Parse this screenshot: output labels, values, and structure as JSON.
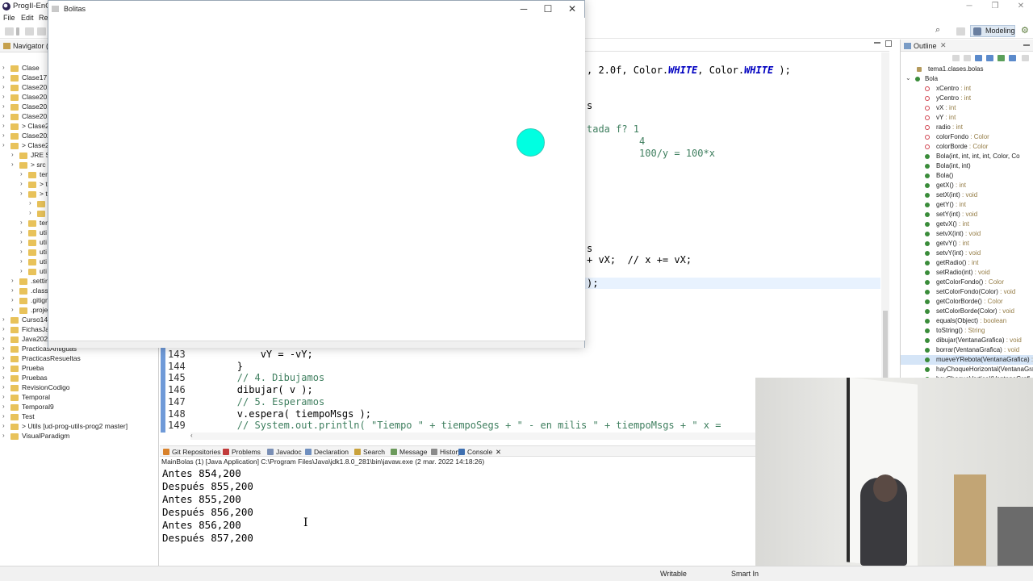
{
  "eclipse": {
    "title": "ProgII-EnCl",
    "menu": [
      "File",
      "Edit",
      "Re"
    ],
    "perspective": "Modeling"
  },
  "navigator": {
    "title": "Navigator (D",
    "items": [
      {
        "label": "Clase",
        "indent": 0
      },
      {
        "label": "Clase17",
        "indent": 0
      },
      {
        "label": "Clase201",
        "indent": 0
      },
      {
        "label": "Clase201",
        "indent": 0
      },
      {
        "label": "Clase201",
        "indent": 0
      },
      {
        "label": "Clase201",
        "indent": 0
      },
      {
        "label": "> Clase2",
        "indent": 0
      },
      {
        "label": "Clase202",
        "indent": 0
      },
      {
        "label": "> Clase2",
        "indent": 0
      },
      {
        "label": "JRE Sy",
        "indent": 1
      },
      {
        "label": "> src",
        "indent": 1
      },
      {
        "label": "ter",
        "indent": 2
      },
      {
        "label": "> t",
        "indent": 2
      },
      {
        "label": "> t",
        "indent": 2
      },
      {
        "label": "",
        "indent": 3
      },
      {
        "label": "",
        "indent": 3
      },
      {
        "label": "ter",
        "indent": 2
      },
      {
        "label": "uti",
        "indent": 2
      },
      {
        "label": "uti",
        "indent": 2
      },
      {
        "label": "uti",
        "indent": 2
      },
      {
        "label": "uti",
        "indent": 2
      },
      {
        "label": "uti",
        "indent": 2
      },
      {
        "label": ".settir",
        "indent": 1
      },
      {
        "label": ".classp",
        "indent": 1
      },
      {
        "label": ".gitign",
        "indent": 1
      },
      {
        "label": ".proje",
        "indent": 1
      },
      {
        "label": "Curso141",
        "indent": 0
      },
      {
        "label": "FichasJav",
        "indent": 0
      },
      {
        "label": "Java2022",
        "indent": 0
      },
      {
        "label": "PracticasAntiguas",
        "indent": 0
      },
      {
        "label": "PracticasResueltas",
        "indent": 0
      },
      {
        "label": "Prueba",
        "indent": 0
      },
      {
        "label": "Pruebas",
        "indent": 0
      },
      {
        "label": "RevisionCodigo",
        "indent": 0
      },
      {
        "label": "Temporal",
        "indent": 0
      },
      {
        "label": "Temporal9",
        "indent": 0
      },
      {
        "label": "Test",
        "indent": 0
      },
      {
        "label": "> Utils [ud-prog-utils-prog2 master]",
        "indent": 0
      },
      {
        "label": "VisualParadigm",
        "indent": 0
      }
    ]
  },
  "editor": {
    "fragments": [
      {
        "text": ", 2.0f, Color.",
        "kw": "WHITE",
        "text2": ", Color.",
        "kw2": "WHITE",
        "text3": " );"
      },
      {
        "text": "s"
      },
      {
        "text": "tada f? 1"
      },
      {
        "text": "         4"
      },
      {
        "text": "         100/y = 100*x"
      },
      {
        "text": "s"
      },
      {
        "text": "+ vX;  // x += vX;"
      },
      {
        "text": ");"
      }
    ],
    "lines": [
      {
        "no": "143",
        "code": "            vY = -vY;"
      },
      {
        "no": "144",
        "code": "        }"
      },
      {
        "no": "145",
        "code": "        // 4. Dibujamos"
      },
      {
        "no": "146",
        "code": "        dibujar( v );"
      },
      {
        "no": "147",
        "code": "        // 5. Esperamos"
      },
      {
        "no": "148",
        "code": "        v.espera( tiempoMsgs );"
      },
      {
        "no": "149",
        "code": "        // System.out.println( \"Tiempo \" + tiempoSegs + \" - en milis \" + tiempoMsgs + \" x ="
      }
    ]
  },
  "outline": {
    "title": "Outline",
    "package": "tema1.clases.bolas",
    "class": "Bola",
    "members": [
      {
        "name": "xCentro",
        "type": " : int",
        "kind": "field"
      },
      {
        "name": "yCentro",
        "type": " : int",
        "kind": "field"
      },
      {
        "name": "vX",
        "type": " : int",
        "kind": "field"
      },
      {
        "name": "vY",
        "type": " : int",
        "kind": "field"
      },
      {
        "name": "radio",
        "type": " : int",
        "kind": "field"
      },
      {
        "name": "colorFondo",
        "type": " : Color",
        "kind": "field"
      },
      {
        "name": "colorBorde",
        "type": " : Color",
        "kind": "field"
      },
      {
        "name": "Bola(int, int, int, int, Color, Co",
        "type": "",
        "kind": "ctor"
      },
      {
        "name": "Bola(int, int)",
        "type": "",
        "kind": "ctor"
      },
      {
        "name": "Bola()",
        "type": "",
        "kind": "ctor"
      },
      {
        "name": "getX()",
        "type": " : int",
        "kind": "method"
      },
      {
        "name": "setX(int)",
        "type": " : void",
        "kind": "method"
      },
      {
        "name": "getY()",
        "type": " : int",
        "kind": "method"
      },
      {
        "name": "setY(int)",
        "type": " : void",
        "kind": "method"
      },
      {
        "name": "getvX()",
        "type": " : int",
        "kind": "method"
      },
      {
        "name": "setvX(int)",
        "type": " : void",
        "kind": "method"
      },
      {
        "name": "getvY()",
        "type": " : int",
        "kind": "method"
      },
      {
        "name": "setvY(int)",
        "type": " : void",
        "kind": "method"
      },
      {
        "name": "getRadio()",
        "type": " : int",
        "kind": "method"
      },
      {
        "name": "setRadio(int)",
        "type": " : void",
        "kind": "method"
      },
      {
        "name": "getColorFondo()",
        "type": " : Color",
        "kind": "method"
      },
      {
        "name": "setColorFondo(Color)",
        "type": " : void",
        "kind": "method"
      },
      {
        "name": "getColorBorde()",
        "type": " : Color",
        "kind": "method"
      },
      {
        "name": "setColorBorde(Color)",
        "type": " : void",
        "kind": "method"
      },
      {
        "name": "equals(Object)",
        "type": " : boolean",
        "kind": "method"
      },
      {
        "name": "toString()",
        "type": " : String",
        "kind": "method"
      },
      {
        "name": "dibujar(VentanaGrafica)",
        "type": " : void",
        "kind": "method"
      },
      {
        "name": "borrar(VentanaGrafica)",
        "type": " : void",
        "kind": "method"
      },
      {
        "name": "mueveYRebota(VentanaGrafica)",
        "type": " : v",
        "kind": "method",
        "selected": true
      },
      {
        "name": "hayChoqueHorizontal(VentanaGra",
        "type": "",
        "kind": "method"
      },
      {
        "name": "hayChoqueVertical(VentanaGrafi",
        "type": "",
        "kind": "method"
      }
    ]
  },
  "console": {
    "tabs": [
      "Git Repositories",
      "Problems",
      "Javadoc",
      "Declaration",
      "Search",
      "Message",
      "History",
      "Console"
    ],
    "info": "MainBolas (1) [Java Application] C:\\Program Files\\Java\\jdk1.8.0_281\\bin\\javaw.exe  (2 mar. 2022 14:18:26)",
    "lines": [
      "Antes 854,200",
      "Después 855,200",
      "Antes 855,200",
      "Después 856,200",
      "Antes 856,200",
      "Después 857,200"
    ]
  },
  "status": {
    "writable": "Writable",
    "insert": "Smart In"
  },
  "bolitas": {
    "title": "Bolitas",
    "ball_color": "#00ffe1"
  }
}
